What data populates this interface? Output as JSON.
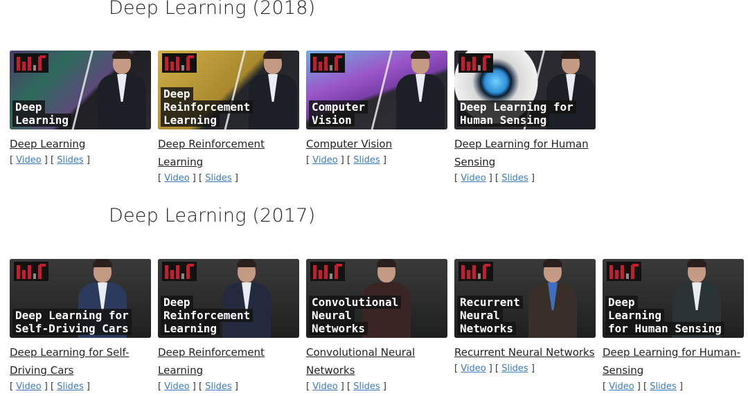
{
  "sections": [
    {
      "title": "Deep Learning (2018)",
      "cards": [
        {
          "caption": [
            "Deep",
            "Learning"
          ],
          "title": "Deep Learning",
          "video": "Video",
          "slides": "Slides",
          "bg": "#3b2f4f"
        },
        {
          "caption": [
            "Deep",
            "Reinforcement",
            "Learning"
          ],
          "title": "Deep Reinforcement Learning",
          "video": "Video",
          "slides": "Slides",
          "bg": "#b8962e"
        },
        {
          "caption": [
            "Computer",
            "Vision"
          ],
          "title": "Computer Vision",
          "video": "Video",
          "slides": "Slides",
          "bg": "#7a3fa8"
        },
        {
          "caption": [
            "Deep Learning for",
            "Human Sensing"
          ],
          "title": "Deep Learning for Human Sensing",
          "video": "Video",
          "slides": "Slides",
          "bg": "#2f6fa8"
        }
      ]
    },
    {
      "title": "Deep Learning (2017)",
      "cards": [
        {
          "caption": [
            "Deep Learning for",
            "Self-Driving Cars"
          ],
          "title": "Deep Learning for Self-Driving Cars",
          "video": "Video",
          "slides": "Slides",
          "bg": "#2c2c2c"
        },
        {
          "caption": [
            "Deep",
            "Reinforcement",
            "Learning"
          ],
          "title": "Deep Reinforcement Learning",
          "video": "Video",
          "slides": "Slides",
          "bg": "#2a2a2a"
        },
        {
          "caption": [
            "Convolutional",
            "Neural",
            "Networks"
          ],
          "title": "Convolutional Neural Networks",
          "video": "Video",
          "slides": "Slides",
          "bg": "#262626"
        },
        {
          "caption": [
            "Recurrent",
            "Neural",
            "Networks"
          ],
          "title": "Recurrent Neural Networks",
          "video": "Video",
          "slides": "Slides",
          "bg": "#282828"
        },
        {
          "caption": [
            "Deep",
            "Learning",
            "for Human Sensing"
          ],
          "title": "Deep Learning for Human-Sensing",
          "video": "Video",
          "slides": "Slides",
          "bg": "#2a2a2a"
        }
      ]
    }
  ],
  "colors": {
    "link": "#3a7bbf",
    "mit_red": "#c41e2e"
  }
}
